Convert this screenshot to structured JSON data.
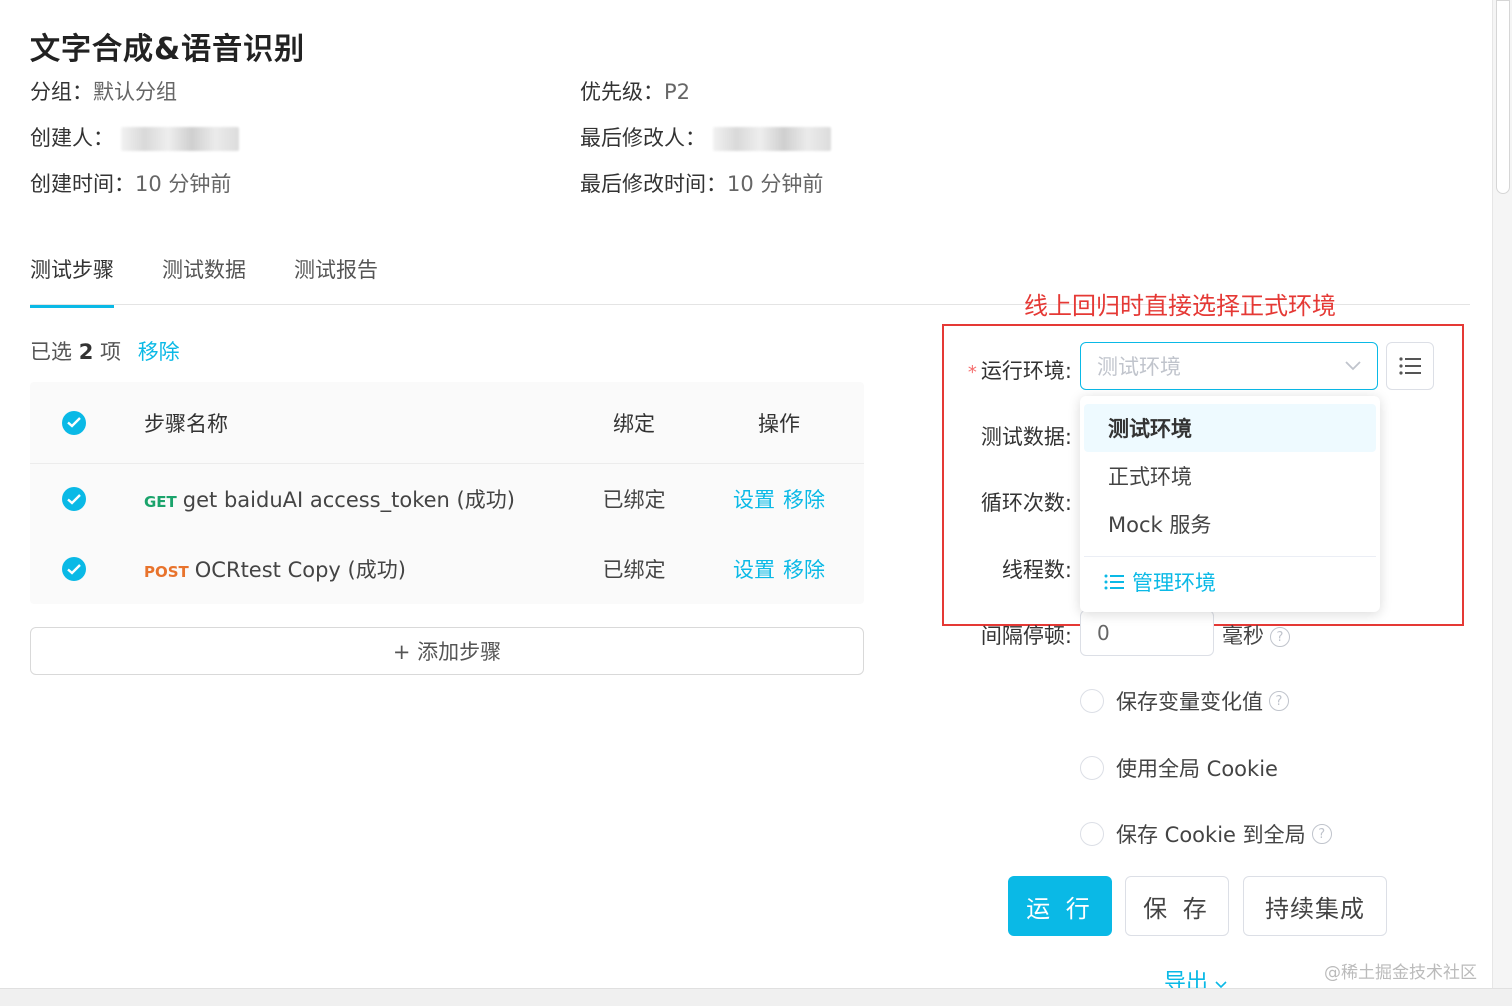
{
  "header": {
    "title": "文字合成&语音识别",
    "group_label": "分组：",
    "group_value": "默认分组",
    "priority_label": "优先级：",
    "priority_value": "P2",
    "creator_label": "创建人：",
    "modifier_label": "最后修改人：",
    "created_label": "创建时间：",
    "created_value": "10 分钟前",
    "modified_label": "最后修改时间：",
    "modified_value": "10 分钟前"
  },
  "tabs": [
    {
      "label": "测试步骤",
      "active": true
    },
    {
      "label": "测试数据",
      "active": false
    },
    {
      "label": "测试报告",
      "active": false
    }
  ],
  "selection": {
    "prefix": "已选",
    "count": "2",
    "suffix": "项",
    "remove": "移除"
  },
  "table": {
    "headers": {
      "name": "步骤名称",
      "bind": "绑定",
      "op": "操作"
    },
    "rows": [
      {
        "method": "GET",
        "name": "get baiduAI access_token (成功)",
        "bind": "已绑定",
        "op_set": "设置",
        "op_remove": "移除"
      },
      {
        "method": "POST",
        "name": "OCRtest Copy (成功)",
        "bind": "已绑定",
        "op_set": "设置",
        "op_remove": "移除"
      }
    ],
    "add_step": "+ 添加步骤"
  },
  "annotation": {
    "text": "线上回归时直接选择正式环境",
    "color": "#e53935"
  },
  "form": {
    "env_label": "运行环境:",
    "env_required_mark": "*",
    "env_placeholder": "测试环境",
    "data_label": "测试数据:",
    "loop_label": "循环次数:",
    "thread_label": "线程数:",
    "interval_label": "间隔停顿:",
    "interval_value": "0",
    "interval_unit": "毫秒",
    "env_options": [
      "测试环境",
      "正式环境",
      "Mock 服务"
    ],
    "env_selected": "测试环境",
    "manage_env": "管理环境",
    "save_var": "保存变量变化值",
    "use_global_cookie": "使用全局 Cookie",
    "save_cookie_global": "保存 Cookie 到全局"
  },
  "buttons": {
    "run": "运 行",
    "save": "保 存",
    "ci": "持续集成"
  },
  "footer": {
    "export": "导出",
    "watermark": "@稀土掘金技术社区"
  },
  "colors": {
    "accent": "#0ab9e6",
    "get": "#1aa36b",
    "post": "#e8732c"
  }
}
